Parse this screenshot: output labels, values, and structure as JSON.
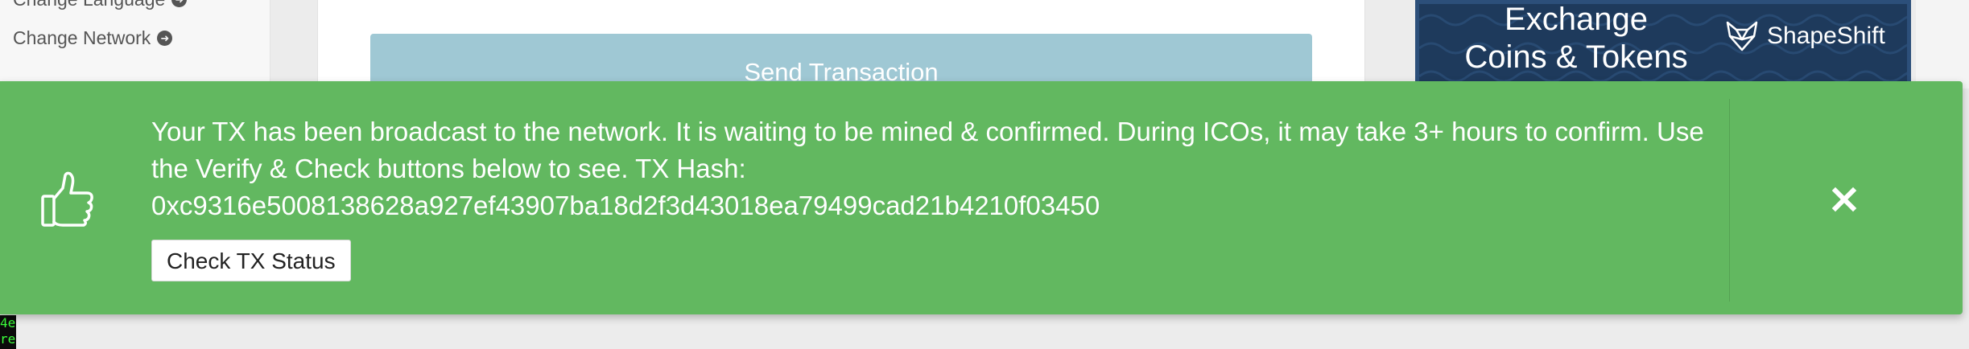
{
  "sidebar": {
    "change_language_label": "Change Language",
    "change_network_label": "Change Network"
  },
  "main": {
    "send_transaction_label": "Send Transaction"
  },
  "ad": {
    "title": "Exchange Coins & Tokens",
    "brand": "ShapeShift",
    "background_color": "#1e3a5c"
  },
  "alert": {
    "message": "Your TX has been broadcast to the network. It is waiting to be mined & confirmed. During ICOs, it may take 3+ hours to confirm. Use the Verify & Check buttons below to see. TX Hash:",
    "tx_hash": "0xc9316e5008138628a927ef43907ba18d2f3d43018ea79499cad21b4210f03450",
    "check_status_label": "Check TX Status",
    "icon": "thumbs-up-icon",
    "close_icon": "close-icon",
    "background_color": "#62b860"
  },
  "terminal": {
    "text": "4e\nre"
  }
}
